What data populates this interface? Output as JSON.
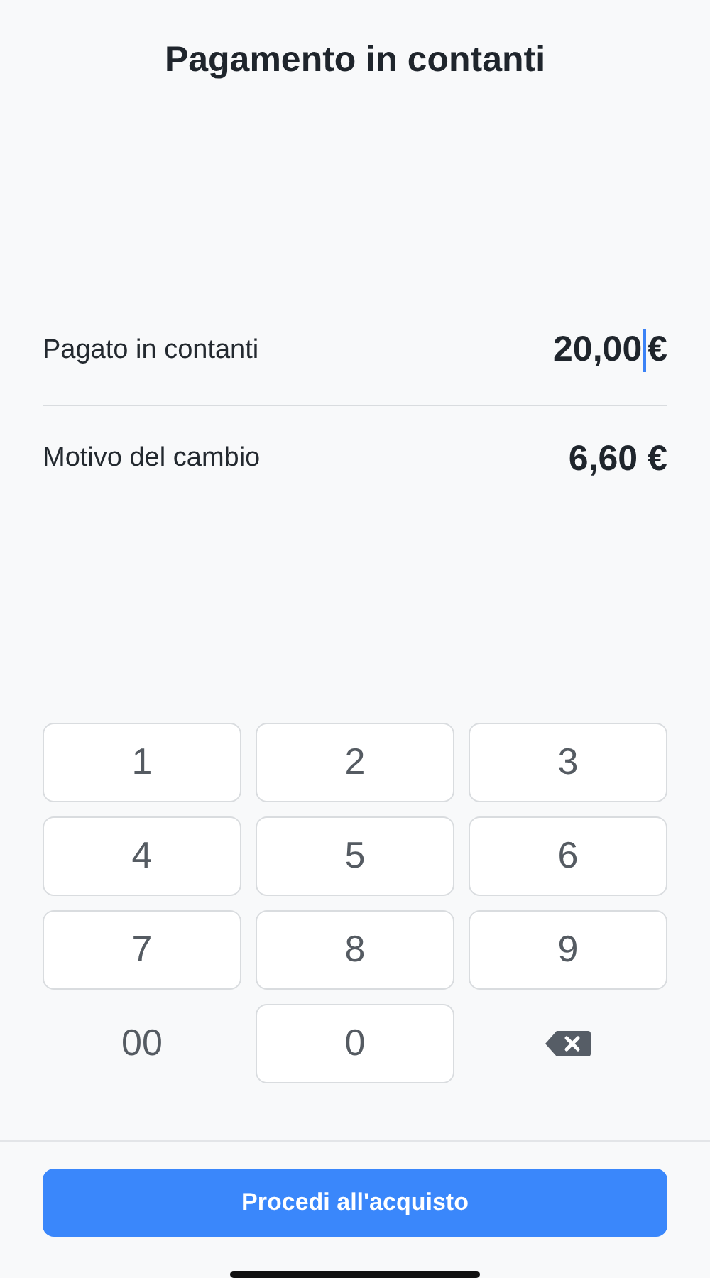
{
  "title": "Pagamento in contanti",
  "rows": [
    {
      "label": "Pagato in contanti",
      "value": "20,00",
      "currency": "€",
      "focused": true
    },
    {
      "label": "Motivo del cambio",
      "value": "6,60",
      "currency": "€",
      "focused": false
    }
  ],
  "keypad": [
    {
      "kind": "key",
      "label": "1"
    },
    {
      "kind": "key",
      "label": "2"
    },
    {
      "kind": "key",
      "label": "3"
    },
    {
      "kind": "key",
      "label": "4"
    },
    {
      "kind": "key",
      "label": "5"
    },
    {
      "kind": "key",
      "label": "6"
    },
    {
      "kind": "key",
      "label": "7"
    },
    {
      "kind": "key",
      "label": "8"
    },
    {
      "kind": "key",
      "label": "9"
    },
    {
      "kind": "plain",
      "label": "00"
    },
    {
      "kind": "key",
      "label": "0"
    },
    {
      "kind": "backspace"
    }
  ],
  "button": "Procedi all'acquisto"
}
